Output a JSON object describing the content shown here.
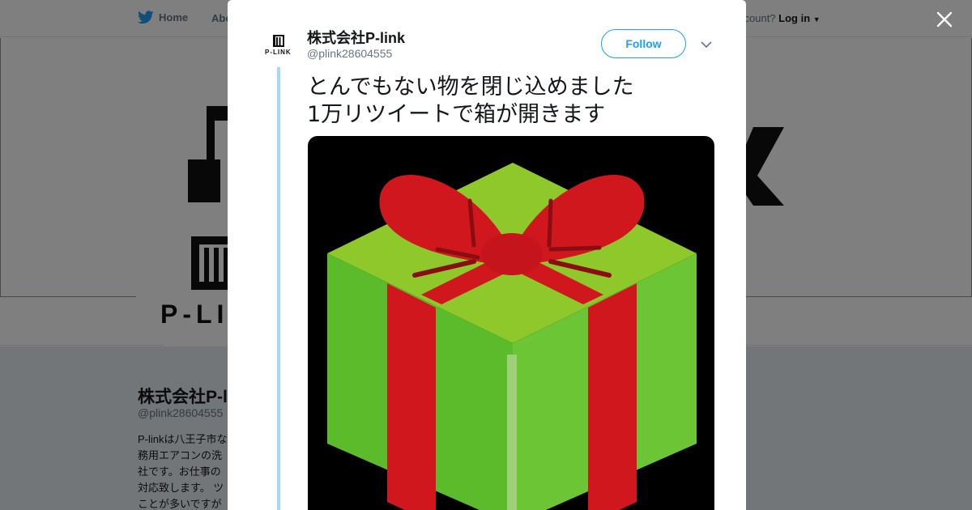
{
  "background": {
    "nav": {
      "home_label": "Home",
      "about_label": "Abo",
      "account_prompt": "ccount?",
      "login_label": "Log in"
    },
    "profile": {
      "name": "株式会社P-l",
      "handle": "@plink28604555",
      "bio_lines": [
        "P-linkは八王子市な",
        "務用エアコンの洗",
        "社です。お仕事の",
        "対応致します。 ツ",
        "ことが多いですが"
      ]
    },
    "banner_logo_text": "P-LI"
  },
  "modal": {
    "account_name": "株式会社P-link",
    "account_handle": "@plink28604555",
    "avatar_text": "P-LINK",
    "follow_label": "Follow",
    "tweet_lines": [
      "とんでもない物を閉じ込めました",
      "1万リツイートで箱が開きます"
    ]
  },
  "colors": {
    "twitter_blue": "#1da1f2",
    "thread_line": "#a4d9f9",
    "box_green": "#6cc02c",
    "ribbon_red": "#d0171d"
  },
  "icons": {
    "home": "twitter-bird-icon",
    "close": "close-icon",
    "more": "chevron-down-icon"
  }
}
